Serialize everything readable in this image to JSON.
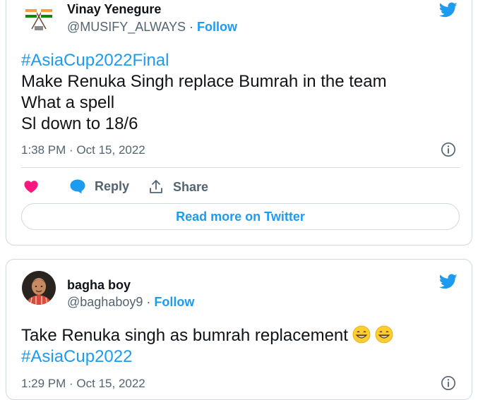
{
  "tweets": [
    {
      "author_name": "Vinay Yenegure",
      "handle": "@MUSIFY_ALWAYS",
      "separator": "·",
      "follow_label": "Follow",
      "lines": [
        "#AsiaCup2022Final",
        "Make Renuka Singh replace Bumrah in the team",
        "What a spell",
        "Sl down to 18/6"
      ],
      "timestamp": "1:38 PM · Oct 15, 2022",
      "actions": {
        "reply_label": "Reply",
        "share_label": "Share"
      },
      "read_more_label": "Read more on Twitter"
    },
    {
      "author_name": "bagha boy",
      "handle": "@baghaboy9",
      "separator": "·",
      "follow_label": "Follow",
      "line1_text": "Take Renuka singh as bumrah replacement",
      "line1_emojis": [
        "grinning-face-with-smiling-eyes",
        "grinning-face-with-smiling-eyes"
      ],
      "line2_hashtag": "#AsiaCup2022",
      "timestamp": "1:29 PM · Oct 15, 2022"
    }
  ],
  "colors": {
    "twitter_blue": "#1d9bf0",
    "like_pink": "#f91880",
    "text_primary": "#0f1419",
    "text_secondary": "#536471",
    "border": "#cfd9de"
  }
}
